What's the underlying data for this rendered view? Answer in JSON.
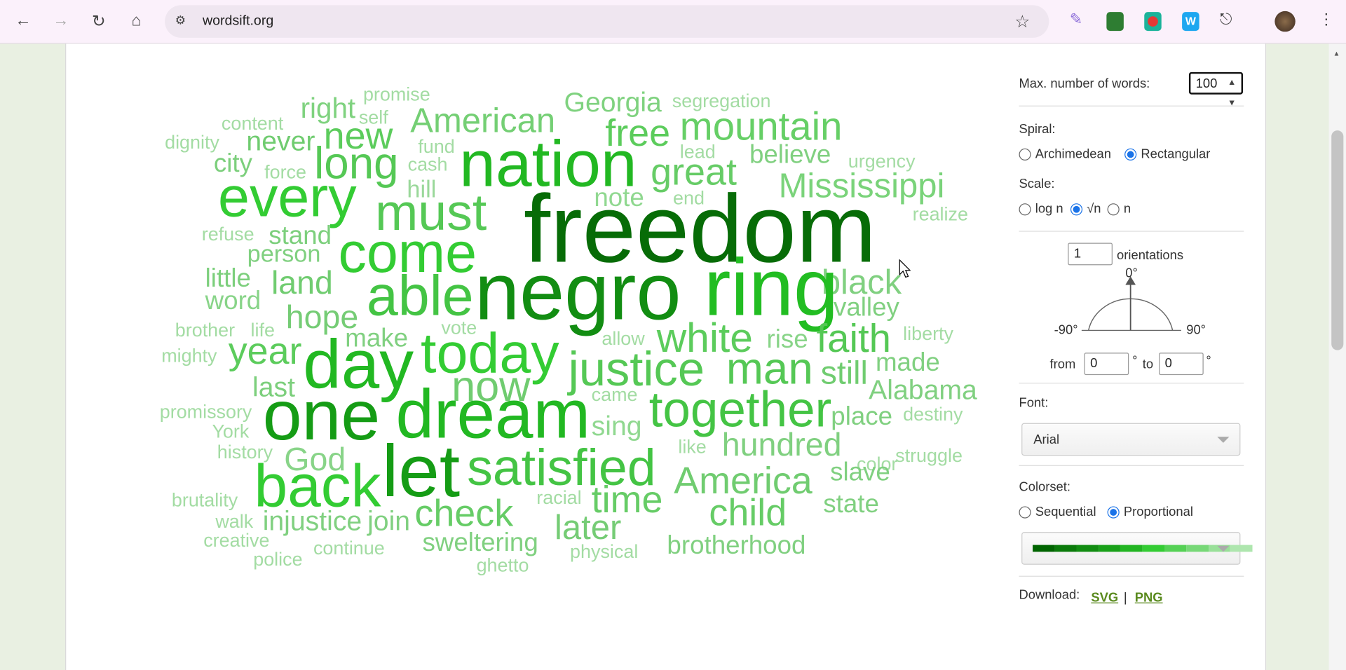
{
  "browser": {
    "url": "wordsift.org",
    "icons": [
      "back-arrow",
      "forward-arrow",
      "reload",
      "home",
      "site-settings",
      "bookmark-star",
      "pen-extension",
      "green-extension",
      "youtube-extension",
      "w-extension",
      "puzzle-extensions",
      "profile-avatar",
      "kebab-menu"
    ]
  },
  "controls": {
    "max_words_label": "Max. number of words:",
    "max_words_value": "100",
    "spiral_label": "Spiral:",
    "spiral_options": [
      "Archimedean",
      "Rectangular"
    ],
    "spiral_selected": "Rectangular",
    "scale_label": "Scale:",
    "scale_options": [
      "log n",
      "√n",
      "n"
    ],
    "scale_selected": "√n",
    "orientations_value": "1",
    "orientations_label": "orientations",
    "angle_top": "0°",
    "angle_left": "-90°",
    "angle_right": "90°",
    "from_label": "from",
    "from_value": "0",
    "deg1": "°",
    "to_label": "to",
    "to_value": "0",
    "deg2": "°",
    "font_label": "Font:",
    "font_value": "Arial",
    "colorset_label": "Colorset:",
    "colorset_options": [
      "Sequential",
      "Proportional"
    ],
    "colorset_selected": "Proportional",
    "colorset_swatch": [
      "#006400",
      "#0a7a0a",
      "#118c11",
      "#18a018",
      "#22b522",
      "#33cc33",
      "#55d155",
      "#77d877",
      "#99e099",
      "#aee6ae"
    ],
    "download_label": "Download:",
    "download_svg": "SVG",
    "download_sep": "|",
    "download_png": "PNG"
  },
  "cloud": {
    "words": [
      {
        "t": "promise",
        "c": "#a3dca3"
      },
      {
        "t": "right",
        "c": "#7fd27f"
      },
      {
        "t": "self",
        "c": "#a3dca3"
      },
      {
        "t": "content",
        "c": "#a3dca3"
      },
      {
        "t": "American",
        "c": "#74cf74"
      },
      {
        "t": "Georgia",
        "c": "#7fd27f"
      },
      {
        "t": "segregation",
        "c": "#a3dca3"
      },
      {
        "t": "dignity",
        "c": "#a3dca3"
      },
      {
        "t": "never",
        "c": "#70cc70"
      },
      {
        "t": "new",
        "c": "#5ccc5c"
      },
      {
        "t": "free",
        "c": "#5ccc5c"
      },
      {
        "t": "mountain",
        "c": "#66cf66"
      },
      {
        "t": "fund",
        "c": "#a3dca3"
      },
      {
        "t": "lead",
        "c": "#a3dca3"
      },
      {
        "t": "believe",
        "c": "#80d080"
      },
      {
        "t": "urgency",
        "c": "#a3dca3"
      },
      {
        "t": "city",
        "c": "#7ccf7c"
      },
      {
        "t": "force",
        "c": "#a3dca3"
      },
      {
        "t": "long",
        "c": "#55c855"
      },
      {
        "t": "cash",
        "c": "#a3dca3"
      },
      {
        "t": "nation",
        "c": "#22b822"
      },
      {
        "t": "great",
        "c": "#66cc66"
      },
      {
        "t": "hill",
        "c": "#9ad89a"
      },
      {
        "t": "Mississippi",
        "c": "#7ad37a"
      },
      {
        "t": "every",
        "c": "#33cc33"
      },
      {
        "t": "note",
        "c": "#90d890"
      },
      {
        "t": "end",
        "c": "#a3dca3"
      },
      {
        "t": "must",
        "c": "#55c855"
      },
      {
        "t": "realize",
        "c": "#a3dca3"
      },
      {
        "t": "refuse",
        "c": "#a3dca3"
      },
      {
        "t": "stand",
        "c": "#7ccf7c"
      },
      {
        "t": "freedom",
        "c": "#076c07"
      },
      {
        "t": "come",
        "c": "#33cc33"
      },
      {
        "t": "person",
        "c": "#80d080"
      },
      {
        "t": "black",
        "c": "#80d080"
      },
      {
        "t": "little",
        "c": "#7ccf7c"
      },
      {
        "t": "land",
        "c": "#70cc70"
      },
      {
        "t": "able",
        "c": "#44c444"
      },
      {
        "t": "negro",
        "c": "#128d12"
      },
      {
        "t": "ring",
        "c": "#22bd22"
      },
      {
        "t": "valley",
        "c": "#80d080"
      },
      {
        "t": "word",
        "c": "#88d488"
      },
      {
        "t": "hope",
        "c": "#75cc75"
      },
      {
        "t": "brother",
        "c": "#a3dca3"
      },
      {
        "t": "life",
        "c": "#a3dca3"
      },
      {
        "t": "make",
        "c": "#80d080"
      },
      {
        "t": "vote",
        "c": "#a3dca3"
      },
      {
        "t": "allow",
        "c": "#a3dca3"
      },
      {
        "t": "white",
        "c": "#5ccc5c"
      },
      {
        "t": "rise",
        "c": "#88d488"
      },
      {
        "t": "faith",
        "c": "#55c855"
      },
      {
        "t": "liberty",
        "c": "#a3dca3"
      },
      {
        "t": "mighty",
        "c": "#a3dca3"
      },
      {
        "t": "year",
        "c": "#5ccc5c"
      },
      {
        "t": "day",
        "c": "#22b822"
      },
      {
        "t": "today",
        "c": "#33cc33"
      },
      {
        "t": "justice",
        "c": "#55c855"
      },
      {
        "t": "man",
        "c": "#55c855"
      },
      {
        "t": "still",
        "c": "#70cc70"
      },
      {
        "t": "made",
        "c": "#80d080"
      },
      {
        "t": "now",
        "c": "#70cc70"
      },
      {
        "t": "last",
        "c": "#7ccf7c"
      },
      {
        "t": "came",
        "c": "#a3dca3"
      },
      {
        "t": "Alabama",
        "c": "#80d080"
      },
      {
        "t": "promissory",
        "c": "#a3dca3"
      },
      {
        "t": "one",
        "c": "#159c15"
      },
      {
        "t": "dream",
        "c": "#22b822"
      },
      {
        "t": "together",
        "c": "#44c444"
      },
      {
        "t": "place",
        "c": "#80d080"
      },
      {
        "t": "destiny",
        "c": "#a3dca3"
      },
      {
        "t": "sing",
        "c": "#90d890"
      },
      {
        "t": "York",
        "c": "#a3dca3"
      },
      {
        "t": "history",
        "c": "#a3dca3"
      },
      {
        "t": "God",
        "c": "#88d488"
      },
      {
        "t": "like",
        "c": "#a3dca3"
      },
      {
        "t": "hundred",
        "c": "#80d080"
      },
      {
        "t": "color",
        "c": "#a3dca3"
      },
      {
        "t": "struggle",
        "c": "#a3dca3"
      },
      {
        "t": "back",
        "c": "#33cc33"
      },
      {
        "t": "let",
        "c": "#159c15"
      },
      {
        "t": "satisfied",
        "c": "#44c444"
      },
      {
        "t": "America",
        "c": "#70cc70"
      },
      {
        "t": "slave",
        "c": "#80d080"
      },
      {
        "t": "brutality",
        "c": "#a3dca3"
      },
      {
        "t": "racial",
        "c": "#a3dca3"
      },
      {
        "t": "time",
        "c": "#66cc66"
      },
      {
        "t": "state",
        "c": "#80d080"
      },
      {
        "t": "check",
        "c": "#66cc66"
      },
      {
        "t": "walk",
        "c": "#a3dca3"
      },
      {
        "t": "injustice",
        "c": "#80d080"
      },
      {
        "t": "join",
        "c": "#80d080"
      },
      {
        "t": "later",
        "c": "#75cc75"
      },
      {
        "t": "child",
        "c": "#66cc66"
      },
      {
        "t": "creative",
        "c": "#a3dca3"
      },
      {
        "t": "sweltering",
        "c": "#80d080"
      },
      {
        "t": "brotherhood",
        "c": "#80d080"
      },
      {
        "t": "continue",
        "c": "#a3dca3"
      },
      {
        "t": "physical",
        "c": "#a3dca3"
      },
      {
        "t": "police",
        "c": "#a3dca3"
      },
      {
        "t": "ghetto",
        "c": "#a3dca3"
      }
    ]
  }
}
